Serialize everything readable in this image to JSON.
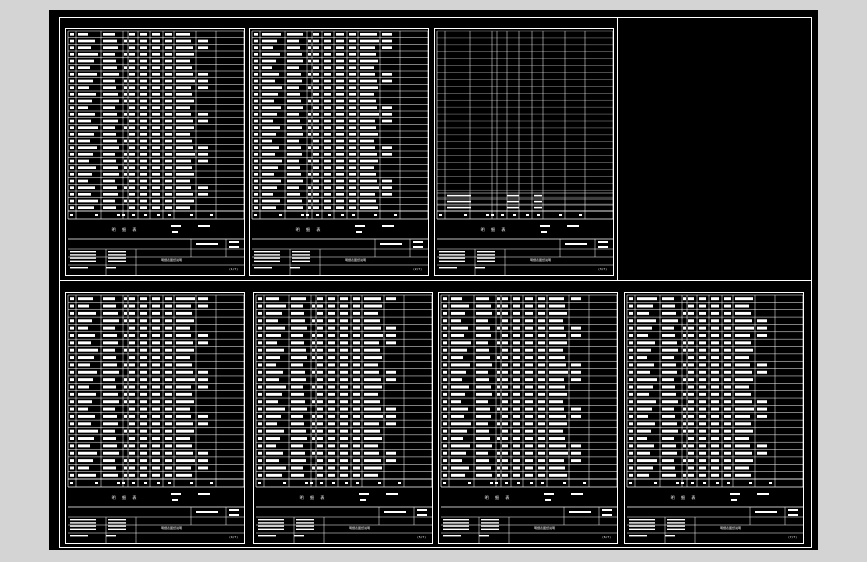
{
  "drawing": {
    "title": "明细表",
    "colors": {
      "background": "#000000",
      "lines": "#ffffff",
      "viewport": "#d4d4d4"
    }
  },
  "sheets": [
    {
      "id": "sheet-1",
      "title": "明 细 表",
      "drawing_name": "明细表图纸说明",
      "sheet_no": "(1/7)",
      "rows": 27,
      "empty": false
    },
    {
      "id": "sheet-2",
      "title": "明 细 表",
      "drawing_name": "明细表图纸说明",
      "sheet_no": "(2/7)",
      "rows": 27,
      "empty": false
    },
    {
      "id": "sheet-3",
      "title": "明 细 表",
      "drawing_name": "明细表图纸说明",
      "sheet_no": "(3/7)",
      "rows": 3,
      "empty": true
    },
    {
      "id": "sheet-4",
      "title": "明 细 表",
      "drawing_name": "明细表图纸说明",
      "sheet_no": "(4/7)",
      "rows": 25,
      "empty": false
    },
    {
      "id": "sheet-5",
      "title": "明 细 表",
      "drawing_name": "明细表图纸说明",
      "sheet_no": "(5/7)",
      "rows": 25,
      "empty": false
    },
    {
      "id": "sheet-6",
      "title": "明 细 表",
      "drawing_name": "明细表图纸说明",
      "sheet_no": "(6/7)",
      "rows": 25,
      "empty": false
    },
    {
      "id": "sheet-7",
      "title": "明 细 表",
      "drawing_name": "明细表图纸说明",
      "sheet_no": "(7/7)",
      "rows": 25,
      "empty": false
    }
  ]
}
